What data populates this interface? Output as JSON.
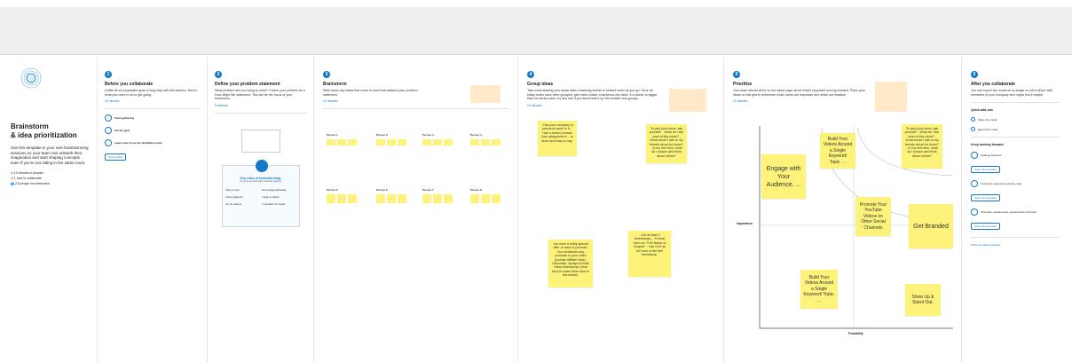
{
  "intro": {
    "title_line1": "Brainstorm",
    "title_line2": "& idea prioritization",
    "description": "Use this template in your own brainstorming sessions so your team can unleash their imagination and start shaping concepts even if you're not sitting in the same room.",
    "stats": [
      "10 minutes to prepare",
      "1 hour to collaborate",
      "2-8 people recommended"
    ]
  },
  "panels": {
    "before": {
      "num": "1",
      "title": "Before you collaborate",
      "text": "A little bit of preparation goes a long way with this session. Here's what you need to do to get going.",
      "mins": "10 minutes",
      "steps": [
        "Team gathering",
        "Set the goal",
        "Learn how to use the facilitation tools"
      ],
      "button": "Open article"
    },
    "define": {
      "num": "2",
      "title": "Define your problem statement",
      "text": "What problem are you trying to solve? Frame your problem as a How Might We statement. This will be the focus of your brainstorm.",
      "mins": "5 minutes",
      "card_title": "Key rules of brainstorming",
      "card_sub": "To run an smooth and productive session",
      "rules": [
        "Stay in topic.",
        "Encourage wild ideas.",
        "Defer judgment.",
        "Listen to others.",
        "Go for volume.",
        "If possible, be visual."
      ]
    },
    "brainstorm": {
      "num": "3",
      "title": "Brainstorm",
      "text": "Write down any ideas that come to mind that address your problem statement.",
      "mins": "10 minutes",
      "people": [
        "Person 1",
        "Person 2",
        "Person 3",
        "Person 4",
        "Person 5",
        "Person 6",
        "Person 7",
        "Person 8"
      ]
    },
    "group": {
      "num": "4",
      "title": "Group ideas",
      "text": "Take turns sharing your ideas while clustering similar or related notes as you go. Once all sticky notes have been grouped, give each cluster a sentence-like label. If a cluster is bigger than six sticky notes, try and see if you and break it up into smaller sub-groups.",
      "mins": "20 minutes",
      "stickies": [
        "- Has your company or personal name in it. - Has a search phrase that categorizes it. - Is short and easy to say.",
        "To pick your niche, ask yourself: - What do I like most of this niche? - What would I talk to my friends about for hours? - Is my free time, what do I search and think about online?",
        "You have a really special offer or want to promote. You mentioned any products in your video (include affiliate links). Otherwise, always include Video timestamps (from hour to make these time in this article).",
        "- List at least 3 timestamps. - Format them as \"0:00 Name of Chapter\" - Use 0:00 as the time of the first timestamp."
      ]
    },
    "prioritize": {
      "num": "5",
      "title": "Prioritize",
      "text": "Your team should all be on the same page about what's important moving forward. Place your ideas on this grid to determine which ideas are important and which are feasible.",
      "mins": "20 minutes",
      "y_label": "Importance",
      "x_label": "Feasibility",
      "stickies": [
        "Engage with Your Audience. ...",
        "Build Your Videos Around a Single Keyword/ Topic. ...",
        "Promote Your YouTube Videos on Other Social Channels",
        "Get Branded",
        "Build Your Videos Around a Single Keyword/ Topic. ...",
        "Show Up & Stand Out.",
        "To pick your niche, ask yourself: - What do I like most of this niche? - What would I talk to my friends about for hours? - In my free time, what do I search and think about online?"
      ]
    },
    "after": {
      "num": "6",
      "title": "After you collaborate",
      "text": "You can export the mural as an image or pdf to share with members of your company who might find it helpful.",
      "quick_title": "Quick add-ons",
      "quick": [
        "Share the mural",
        "Export the mural"
      ],
      "keep_title": "Keep moving forward",
      "keep": [
        "Strategy blueprint",
        "Customer experience journey map",
        "Strengths, weaknesses, opportunities & threats"
      ],
      "open_label": "Open the template",
      "feedback": "Share template feedback"
    }
  },
  "colors": {
    "accent": "#1479c6",
    "sticky": "#fdf37a",
    "note": "#ffe9c8"
  }
}
